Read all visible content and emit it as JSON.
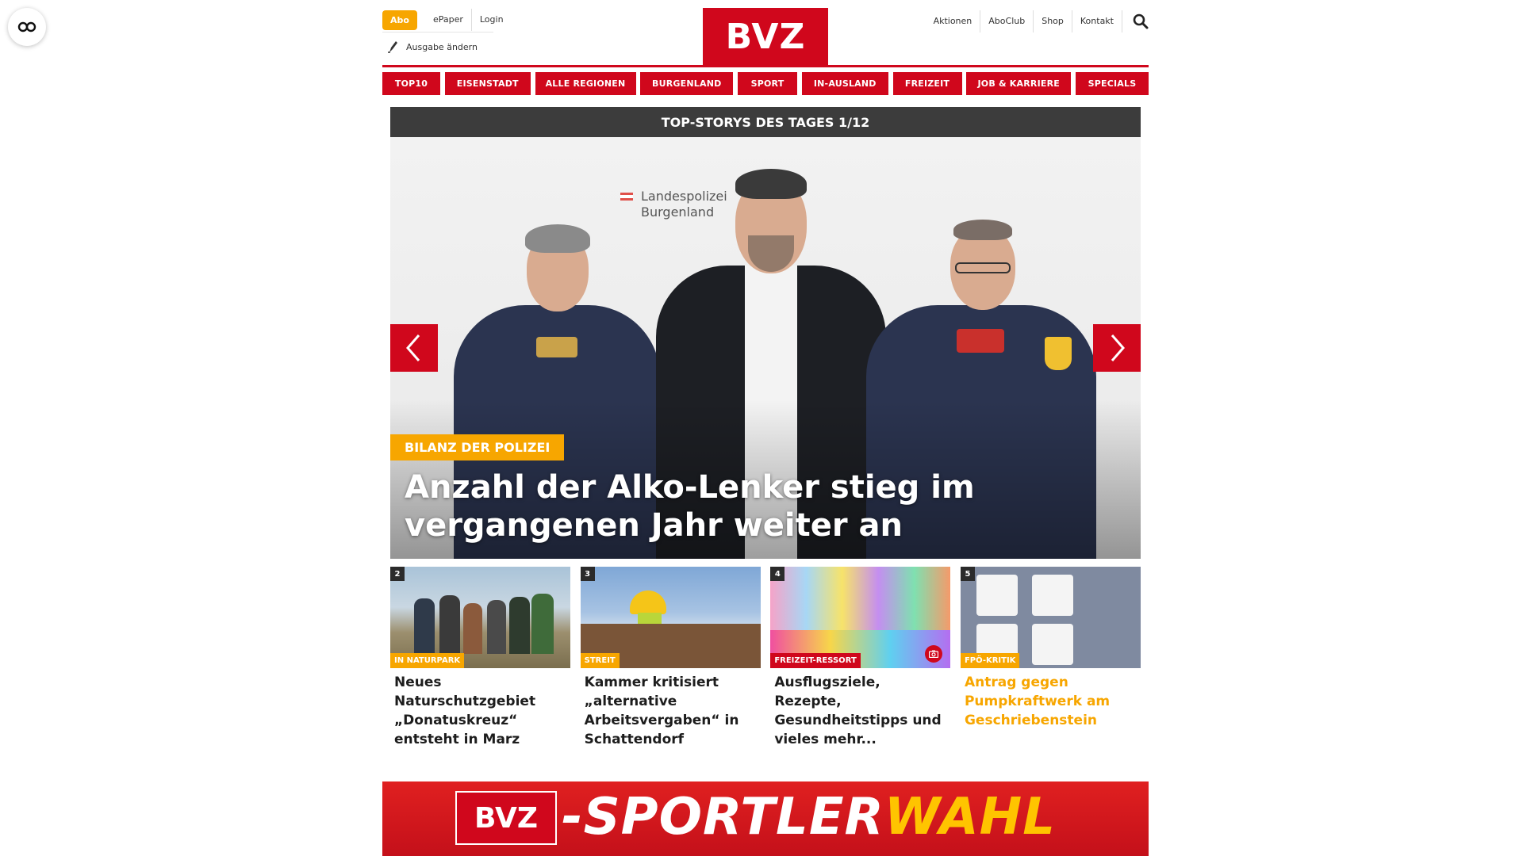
{
  "header": {
    "abo_label": "Abo",
    "epaper_label": "ePaper",
    "login_label": "Login",
    "ausgabe_label": "Ausgabe ändern",
    "logo_text": "BVZ",
    "right_links": [
      "Aktionen",
      "AboClub",
      "Shop",
      "Kontakt"
    ]
  },
  "nav": {
    "items": [
      "TOP10",
      "EISENSTADT",
      "ALLE REGIONEN",
      "BURGENLAND",
      "SPORT",
      "IN-AUSLAND",
      "FREIZEIT",
      "JOB & KARRIERE",
      "SPECIALS"
    ]
  },
  "top_stories": {
    "header": "TOP-STORYS DES TAGES 1/12",
    "wall_sign_line1": "Landespolizei",
    "wall_sign_line2": "Burgenland",
    "hero": {
      "label": "BILANZ DER POLIZEI",
      "title": "Anzahl der Alko-Lenker stieg im vergangenen Jahr weiter an"
    }
  },
  "teasers": [
    {
      "num": "2",
      "tag": "IN NATURPARK",
      "tag_color": "#f7a600",
      "title": "Neues Naturschutzgebiet „Donatuskreuz“ entsteht in Marz",
      "orange": false
    },
    {
      "num": "3",
      "tag": "STREIT",
      "tag_color": "#f7a600",
      "title": "Kammer kritisiert „alternative Arbeitsvergaben“ in Schattendorf",
      "orange": false
    },
    {
      "num": "4",
      "tag": "FREIZEIT-RESSORT",
      "tag_color": "#d0071c",
      "title": "Ausflugsziele, Rezepte, Gesundheitstipps und vieles mehr...",
      "orange": false
    },
    {
      "num": "5",
      "tag": "FPÖ-KRITIK",
      "tag_color": "#f7a600",
      "title": "Antrag gegen Pumpkraftwerk am Geschriebenstein",
      "orange": true
    }
  ],
  "banner": {
    "logo_text": "BVZ",
    "text_white": "-SPORTLER",
    "text_yellow": "WAHL"
  },
  "colors": {
    "brand_red": "#d0071c",
    "accent_orange": "#f7a600",
    "dark_bar": "#3c3c3c"
  }
}
